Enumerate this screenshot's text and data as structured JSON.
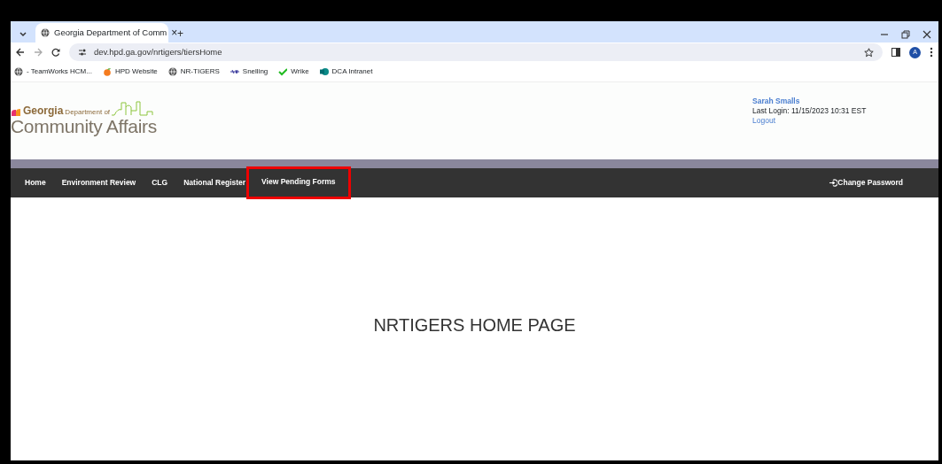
{
  "browser": {
    "tab": {
      "title": "Georgia Department of Comm",
      "close": "×"
    },
    "new_tab": "+",
    "url": "dev.hpd.ga.gov/nrtigers/tiersHome",
    "profile": "A",
    "bookmarks": [
      {
        "label": "- TeamWorks HCM...",
        "kind": "globe"
      },
      {
        "label": "HPD Website",
        "kind": "peach"
      },
      {
        "label": "NR-TIGERS",
        "kind": "globe"
      },
      {
        "label": "Snelling",
        "kind": "snelling"
      },
      {
        "label": "Wrike",
        "kind": "check"
      },
      {
        "label": "DCA Intranet",
        "kind": "sharepoint"
      }
    ]
  },
  "header": {
    "logo": {
      "brand": "Georgia",
      "sub": "Department of",
      "name": "Community Affairs"
    },
    "user": "Sarah Smalls",
    "last_login": "Last Login: 11/15/2023 10:31 EST",
    "logout": "Logout"
  },
  "nav": {
    "items": [
      {
        "label": "Home",
        "highlighted": false
      },
      {
        "label": "Environment Review",
        "highlighted": false
      },
      {
        "label": "CLG",
        "highlighted": false
      },
      {
        "label": "National Register",
        "highlighted": false
      },
      {
        "label": "View Pending Forms",
        "highlighted": true
      }
    ],
    "change_password": "Change Password"
  },
  "main": {
    "heading": "NRTIGERS HOME PAGE"
  }
}
